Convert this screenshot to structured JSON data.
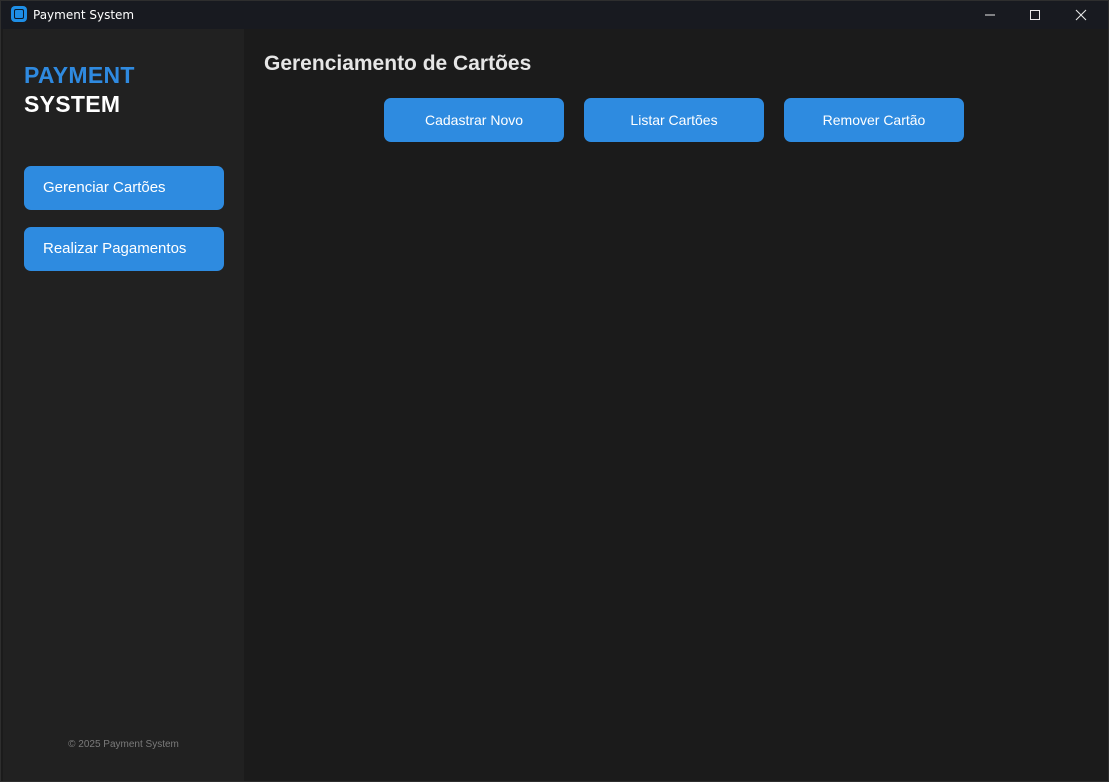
{
  "window": {
    "title": "Payment System",
    "app_icon": "app-square-icon",
    "controls": {
      "minimize_icon": "minimize-icon",
      "maximize_icon": "maximize-icon",
      "close_icon": "close-icon"
    }
  },
  "sidebar": {
    "brand_line1": "PAYMENT",
    "brand_line2": "SYSTEM",
    "items": [
      {
        "label": "Gerenciar Cartões"
      },
      {
        "label": "Realizar Pagamentos"
      }
    ],
    "footer": "© 2025 Payment System"
  },
  "main": {
    "title": "Gerenciamento de Cartões",
    "actions": [
      {
        "label": "Cadastrar Novo"
      },
      {
        "label": "Listar Cartões"
      },
      {
        "label": "Remover Cartão"
      }
    ]
  },
  "colors": {
    "accent": "#2e8be0",
    "brand_blue": "#2f8ae0",
    "sidebar_bg": "#212121",
    "main_bg": "#1b1b1b",
    "titlebar_bg": "#181a20"
  }
}
